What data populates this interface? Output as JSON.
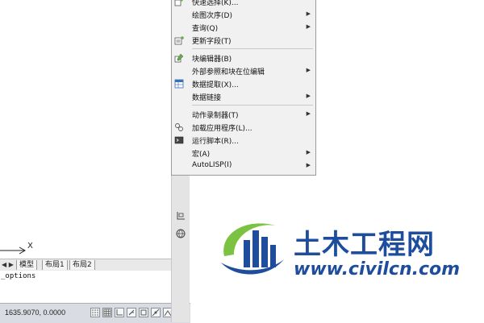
{
  "menu": {
    "items": [
      {
        "label": "快速选择(K)...",
        "icon": "quick-select-icon",
        "submenu": false
      },
      {
        "label": "绘图次序(D)",
        "icon": "",
        "submenu": true
      },
      {
        "label": "查询(Q)",
        "icon": "",
        "submenu": true
      },
      {
        "label": "更新字段(T)",
        "icon": "update-fields-icon",
        "submenu": false
      },
      {
        "label": "块编辑器(B)",
        "icon": "block-editor-icon",
        "submenu": false
      },
      {
        "label": "外部参照和块在位编辑",
        "icon": "",
        "submenu": true
      },
      {
        "label": "数据提取(X)...",
        "icon": "data-extraction-icon",
        "submenu": false
      },
      {
        "label": "数据链接",
        "icon": "",
        "submenu": true
      },
      {
        "label": "动作录制器(T)",
        "icon": "",
        "submenu": true
      },
      {
        "label": "加载应用程序(L)...",
        "icon": "load-application-icon",
        "submenu": false
      },
      {
        "label": "运行脚本(R)...",
        "icon": "run-script-icon",
        "submenu": false
      },
      {
        "label": "宏(A)",
        "icon": "",
        "submenu": true
      },
      {
        "label": "AutoLISP(I)",
        "icon": "",
        "submenu": true
      }
    ],
    "arrow_glyph": "▶"
  },
  "drawing": {
    "axis_label": "X"
  },
  "layout_tabs": {
    "nav": "◀ ▶",
    "tabs": [
      "模型",
      "布局1",
      "布局2"
    ]
  },
  "command_line": {
    "text": "_options"
  },
  "status_bar": {
    "coordinates": "1635.9070, 0.0000"
  },
  "watermark": {
    "title": "土木工程网",
    "url": "www.civilcn.com"
  },
  "colors": {
    "menu_bg": "#f1f1f1",
    "brand_blue": "#1d4d9c",
    "brand_green": "#7cc242",
    "arrow_red": "#d62020"
  }
}
